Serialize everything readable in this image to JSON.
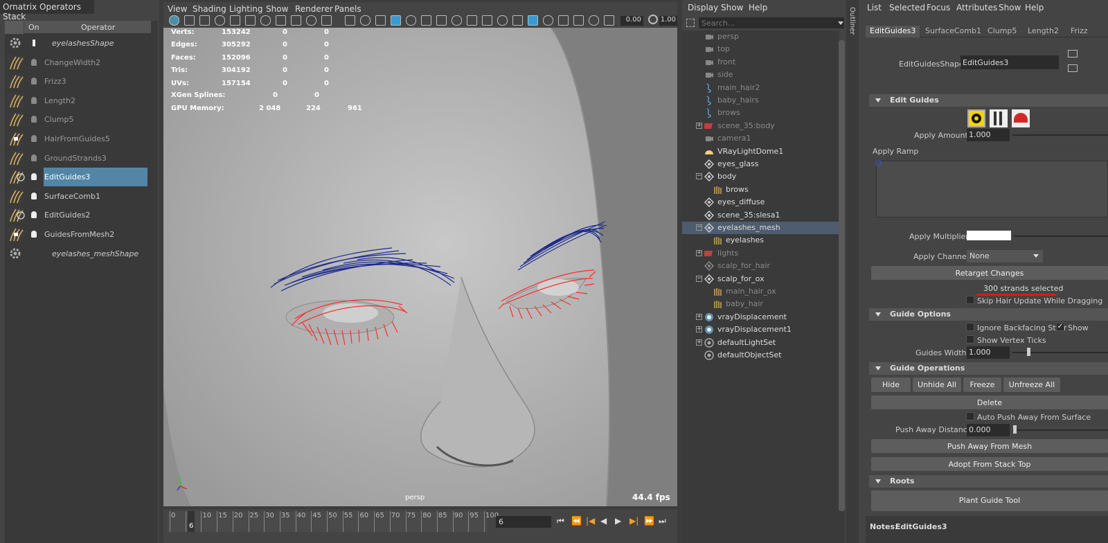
{
  "ops_panel": {
    "title": "Ornatrix Operators Stack",
    "col_on": "On",
    "col_operator": "Operator",
    "items": [
      {
        "name": "eyelashesShape",
        "icon": "gear-icon",
        "state": "shape"
      },
      {
        "name": "ChangeWidth2",
        "icon": "change-width-icon",
        "state": "dim"
      },
      {
        "name": "Frizz3",
        "icon": "frizz-icon",
        "state": "dim"
      },
      {
        "name": "Length2",
        "icon": "length-icon",
        "state": "dim"
      },
      {
        "name": "Clump5",
        "icon": "clump-icon",
        "state": "dim"
      },
      {
        "name": "HairFromGuides5",
        "icon": "hair-from-guides-icon",
        "state": "dim"
      },
      {
        "name": "GroundStrands3",
        "icon": "ground-strands-icon",
        "state": "dim"
      },
      {
        "name": "EditGuides3",
        "icon": "edit-guides-icon",
        "state": "selected"
      },
      {
        "name": "SurfaceComb1",
        "icon": "surface-comb-icon",
        "state": "on"
      },
      {
        "name": "EditGuides2",
        "icon": "edit-guides-icon",
        "state": "on"
      },
      {
        "name": "GuidesFromMesh2",
        "icon": "guides-from-mesh-icon",
        "state": "on"
      },
      {
        "name": "eyelashes_meshShape",
        "icon": "gear-icon",
        "state": "shape"
      }
    ]
  },
  "viewport": {
    "menus": [
      "View",
      "Shading",
      "Lighting",
      "Show",
      "Renderer",
      "Panels"
    ],
    "field_exposure": "0.00",
    "field_gamma": "1.00",
    "hud": [
      {
        "label": "Verts:",
        "a": "153242",
        "b": "0",
        "c": "0"
      },
      {
        "label": "Edges:",
        "a": "305292",
        "b": "0",
        "c": "0"
      },
      {
        "label": "Faces:",
        "a": "152096",
        "b": "0",
        "c": "0"
      },
      {
        "label": "Tris:",
        "a": "304192",
        "b": "0",
        "c": "0"
      },
      {
        "label": "UVs:",
        "a": "157154",
        "b": "0",
        "c": "0"
      }
    ],
    "xgen_label": "XGen Splines:",
    "xgen_a": "0",
    "xgen_b": "0",
    "gpu_label": "GPU Memory:",
    "gpu_a": "2 048",
    "gpu_b": "224",
    "gpu_c": "961",
    "camera": "persp",
    "fps": "44.4 fps",
    "colors": {
      "selected_strands": "#ff2a2a",
      "guides": "#1c2a8c"
    }
  },
  "timeline": {
    "ticks": [
      "0",
      "5",
      "10",
      "15",
      "20",
      "25",
      "30",
      "35",
      "40",
      "45",
      "50",
      "55",
      "60",
      "65",
      "70",
      "75",
      "80",
      "85",
      "90",
      "95",
      "100"
    ],
    "current_marker": "6",
    "current_frame": "6"
  },
  "outliner": {
    "menus": [
      "Display",
      "Show",
      "Help"
    ],
    "search_placeholder": "Search...",
    "side_tab": "Outliner",
    "rows": [
      {
        "label": "persp",
        "icon": "camera-icon",
        "indent": 0,
        "dim": true,
        "expander": ""
      },
      {
        "label": "top",
        "icon": "camera-icon",
        "indent": 0,
        "dim": true,
        "expander": ""
      },
      {
        "label": "front",
        "icon": "camera-icon",
        "indent": 0,
        "dim": true,
        "expander": ""
      },
      {
        "label": "side",
        "icon": "camera-icon",
        "indent": 0,
        "dim": true,
        "expander": ""
      },
      {
        "label": "main_hair2",
        "icon": "curve-icon",
        "indent": 0,
        "dim": true,
        "expander": ""
      },
      {
        "label": "baby_hairs",
        "icon": "curve-icon",
        "indent": 0,
        "dim": true,
        "expander": ""
      },
      {
        "label": "brows",
        "icon": "curve-icon",
        "indent": 0,
        "dim": true,
        "expander": ""
      },
      {
        "label": "scene_35:body",
        "icon": "render-set-icon",
        "indent": 0,
        "dim": true,
        "expander": "+"
      },
      {
        "label": "camera1",
        "icon": "camera-icon",
        "indent": 0,
        "dim": true,
        "expander": ""
      },
      {
        "label": "VRayLightDome1",
        "icon": "dome-light-icon",
        "indent": 0,
        "dim": false,
        "expander": ""
      },
      {
        "label": "eyes_glass",
        "icon": "transform-icon",
        "indent": 0,
        "dim": false,
        "expander": ""
      },
      {
        "label": "body",
        "icon": "transform-icon",
        "indent": 0,
        "dim": false,
        "expander": "-"
      },
      {
        "label": "brows",
        "icon": "hair-icon",
        "indent": 1,
        "dim": false,
        "expander": ""
      },
      {
        "label": "eyes_diffuse",
        "icon": "transform-icon",
        "indent": 0,
        "dim": false,
        "expander": ""
      },
      {
        "label": "scene_35:slesa1",
        "icon": "transform-icon",
        "indent": 0,
        "dim": false,
        "expander": ""
      },
      {
        "label": "eyelashes_mesh",
        "icon": "transform-icon",
        "indent": 0,
        "dim": false,
        "expander": "-",
        "selected": true
      },
      {
        "label": "eyelashes",
        "icon": "hair-icon",
        "indent": 1,
        "dim": false,
        "expander": ""
      },
      {
        "label": "lights",
        "icon": "render-set-icon",
        "indent": 0,
        "dim": true,
        "expander": "+"
      },
      {
        "label": "scalp_for_hair",
        "icon": "transform-icon",
        "indent": 0,
        "dim": true,
        "expander": ""
      },
      {
        "label": "scalp_for_ox",
        "icon": "transform-icon",
        "indent": 0,
        "dim": false,
        "expander": "-"
      },
      {
        "label": "main_hair_ox",
        "icon": "hair-icon",
        "indent": 1,
        "dim": true,
        "expander": ""
      },
      {
        "label": "baby_hair",
        "icon": "hair-icon",
        "indent": 1,
        "dim": true,
        "expander": ""
      },
      {
        "label": "vrayDisplacement",
        "icon": "vray-icon",
        "indent": 0,
        "dim": false,
        "expander": "+"
      },
      {
        "label": "vrayDisplacement1",
        "icon": "vray-icon",
        "indent": 0,
        "dim": false,
        "expander": "+"
      },
      {
        "label": "defaultLightSet",
        "icon": "set-icon",
        "indent": 0,
        "dim": false,
        "expander": "+"
      },
      {
        "label": "defaultObjectSet",
        "icon": "set-icon",
        "indent": 0,
        "dim": false,
        "expander": ""
      }
    ]
  },
  "attr_editor": {
    "menus": [
      "List",
      "Selected",
      "Focus",
      "Attributes",
      "Show",
      "Help"
    ],
    "tabs": [
      "EditGuides3",
      "SurfaceComb1",
      "Clump5",
      "Length2",
      "Frizz"
    ],
    "shape_label": "EditGuidesShape:",
    "shape_value": "EditGuides3",
    "sections": {
      "edit_guides": "Edit Guides",
      "guide_options": "Guide Options",
      "guide_operations": "Guide Operations",
      "roots": "Roots"
    },
    "apply_amount_label": "Apply Amount",
    "apply_amount": "1.000",
    "apply_ramp_label": "Apply Ramp",
    "apply_multiplier_label": "Apply Multiplier",
    "apply_channel_label": "Apply Channel",
    "apply_channel": "None",
    "retarget_button": "Retarget Changes",
    "strands_selected": "300 strands selected",
    "skip_update": "Skip Hair Update While Dragging",
    "ignore_backfacing": "Ignore Backfacing Strar",
    "show_label": "Show",
    "show_vertex_ticks": "Show Vertex Ticks",
    "guides_width_label": "Guides Width",
    "guides_width": "1.000",
    "hide_btn": "Hide",
    "unhide_all_btn": "Unhide All",
    "freeze_btn": "Freeze",
    "unfreeze_all_btn": "Unfreeze All",
    "delete_btn": "Delete",
    "auto_push": "Auto Push Away From Surface",
    "push_away_label": "Push Away Distance",
    "push_away_value": "0.000",
    "push_away_btn": "Push Away From Mesh",
    "adopt_btn": "Adopt From Stack Top",
    "plant_btn": "Plant Guide Tool",
    "notes_label": "Notes:",
    "notes_value": "EditGuides3",
    "brush_mode_colors": {
      "active": "#f5d400",
      "fill": "#d42828"
    }
  }
}
